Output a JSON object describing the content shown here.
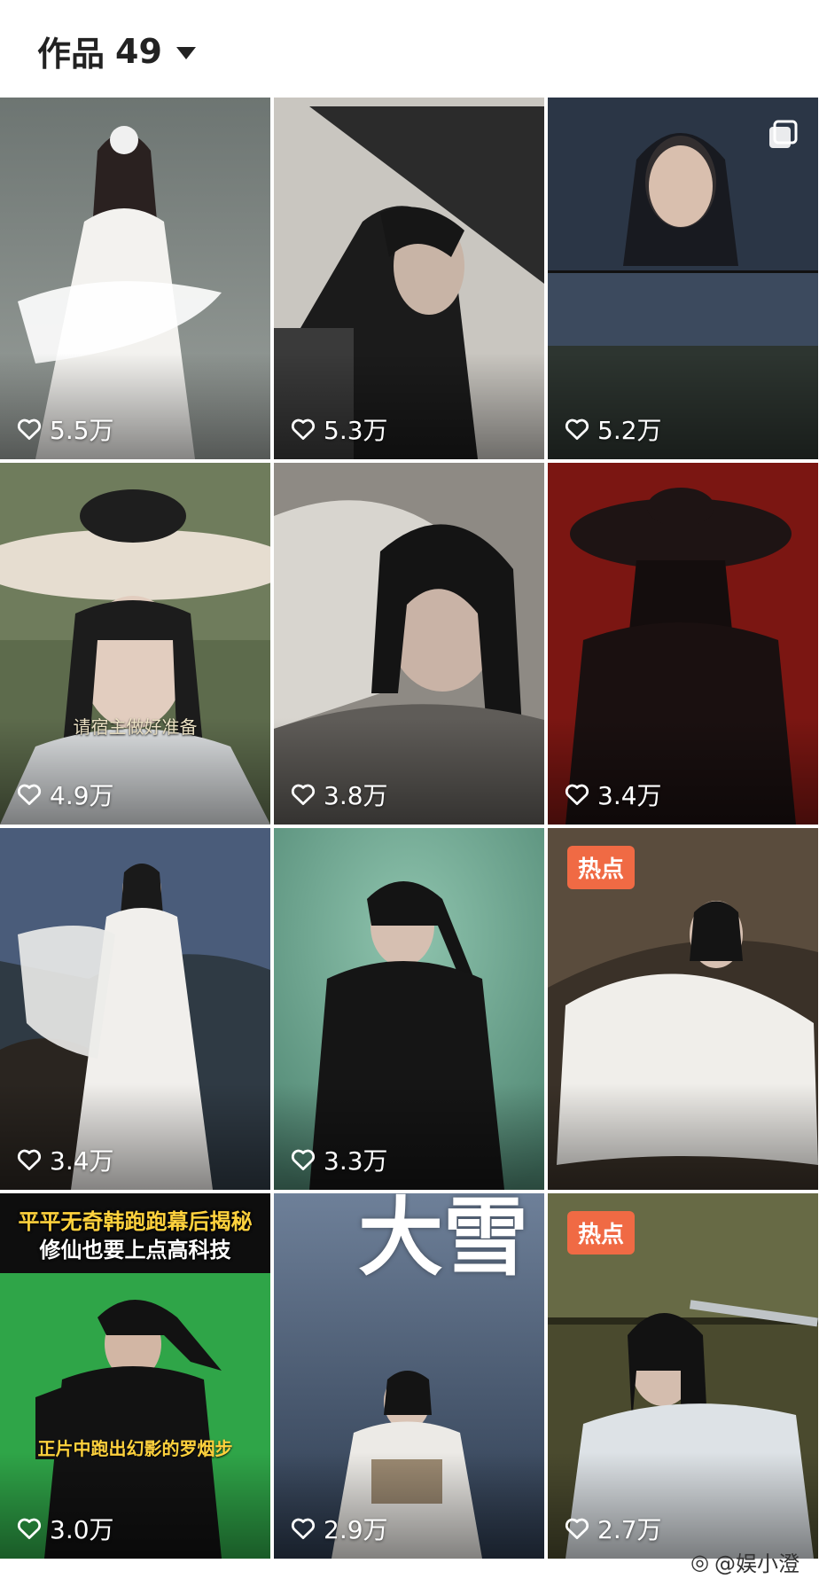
{
  "header": {
    "title": "作品",
    "count": "49"
  },
  "tiles": [
    {
      "likes": "5.5万"
    },
    {
      "likes": "5.3万"
    },
    {
      "likes": "5.2万"
    },
    {
      "likes": "4.9万",
      "caption": "请宿主做好准备"
    },
    {
      "likes": "3.8万"
    },
    {
      "likes": "3.4万"
    },
    {
      "likes": "3.4万"
    },
    {
      "likes": "3.3万"
    },
    {
      "likes": "",
      "badge": "热点"
    },
    {
      "likes": "3.0万",
      "banner_line1": "平平无奇韩跑跑幕后揭秘",
      "banner_line2": "修仙也要上点高科技",
      "caption": "正片中跑出幻影的罗烟步"
    },
    {
      "likes": "2.9万",
      "big_title": "大雪"
    },
    {
      "likes": "2.7万",
      "badge": "热点"
    }
  ],
  "watermark": "@娱小澄",
  "colors": {
    "badge": "#f06a44",
    "header_text": "#222222"
  }
}
